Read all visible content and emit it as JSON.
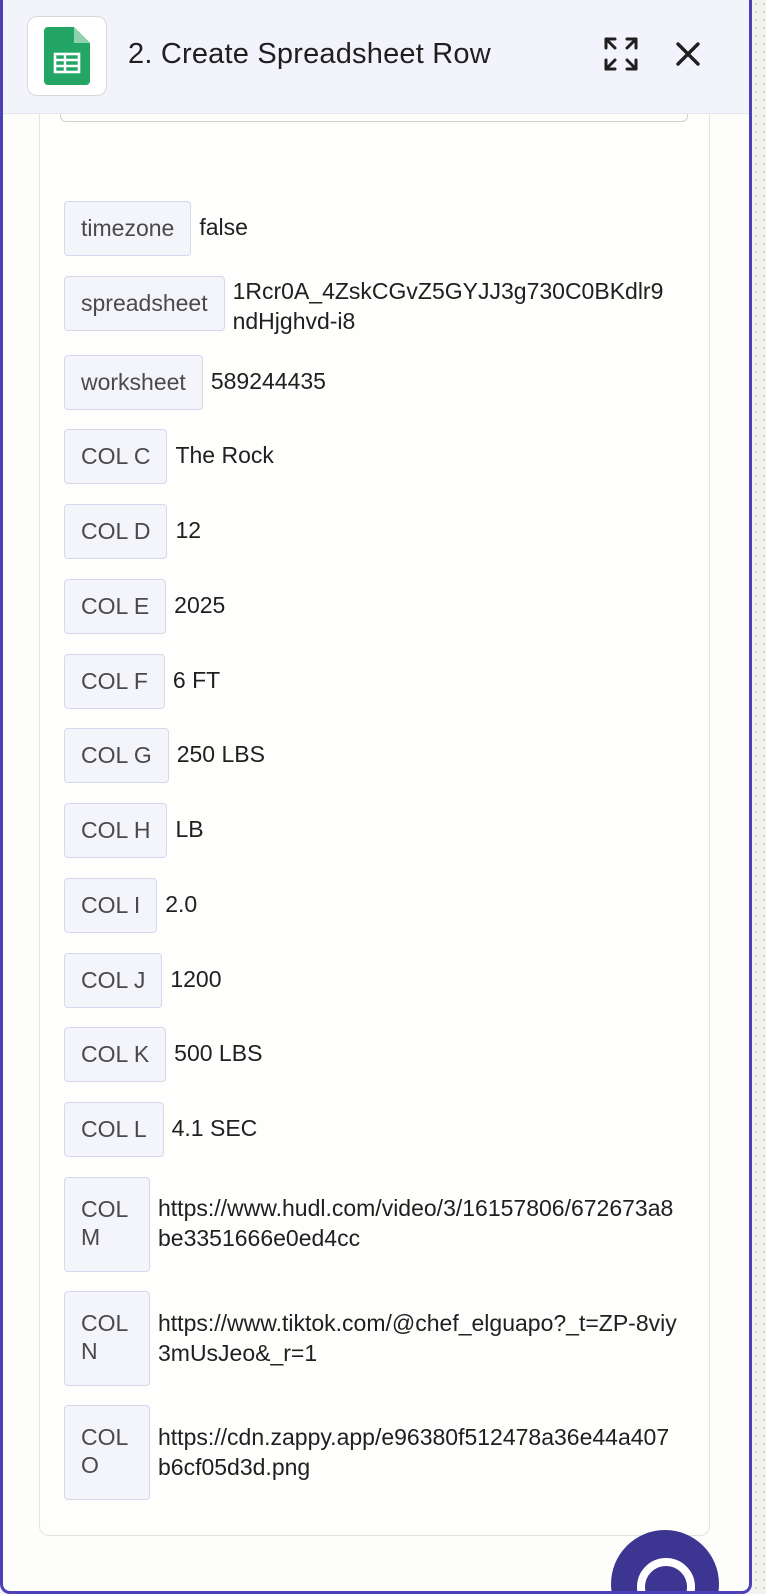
{
  "header": {
    "title": "2. Create Spreadsheet Row",
    "app_icon": "google-sheets-icon",
    "expand_icon": "expand-icon",
    "close_icon": "close-icon"
  },
  "colors": {
    "panel_border": "#4b40b8",
    "header_bg": "#f3f3fb",
    "key_bg": "#f4f4fb",
    "key_border": "#d6d6ee",
    "sheets_green": "#23a566",
    "chat_bubble": "#3d3592"
  },
  "rows": [
    {
      "key": "timezone",
      "value": "false"
    },
    {
      "key": "spreadsheet",
      "value": "1Rcr0A_4ZskCGvZ5GYJJ3g730C0BKdlr9ndHjghvd-i8"
    },
    {
      "key": "worksheet",
      "value": "589244435"
    },
    {
      "key": "COL C",
      "value": "The Rock"
    },
    {
      "key": "COL D",
      "value": "12"
    },
    {
      "key": "COL E",
      "value": "2025"
    },
    {
      "key": "COL F",
      "value": "6 FT"
    },
    {
      "key": "COL G",
      "value": "250 LBS"
    },
    {
      "key": "COL H",
      "value": "LB"
    },
    {
      "key": "COL I",
      "value": "2.0"
    },
    {
      "key": "COL J",
      "value": "1200"
    },
    {
      "key": "COL K",
      "value": "500 LBS"
    },
    {
      "key": "COL L",
      "value": "4.1 SEC"
    },
    {
      "key": "COL M",
      "value": "https://www.hudl.com/video/3/16157806/672673a8be3351666e0ed4cc"
    },
    {
      "key": "COL N",
      "value": "https://www.tiktok.com/@chef_elguapo?_t=ZP-8viy3mUsJeo&_r=1"
    },
    {
      "key": "COL O",
      "value": "https://cdn.zappy.app/e96380f512478a36e44a407b6cf05d3d.png"
    }
  ]
}
